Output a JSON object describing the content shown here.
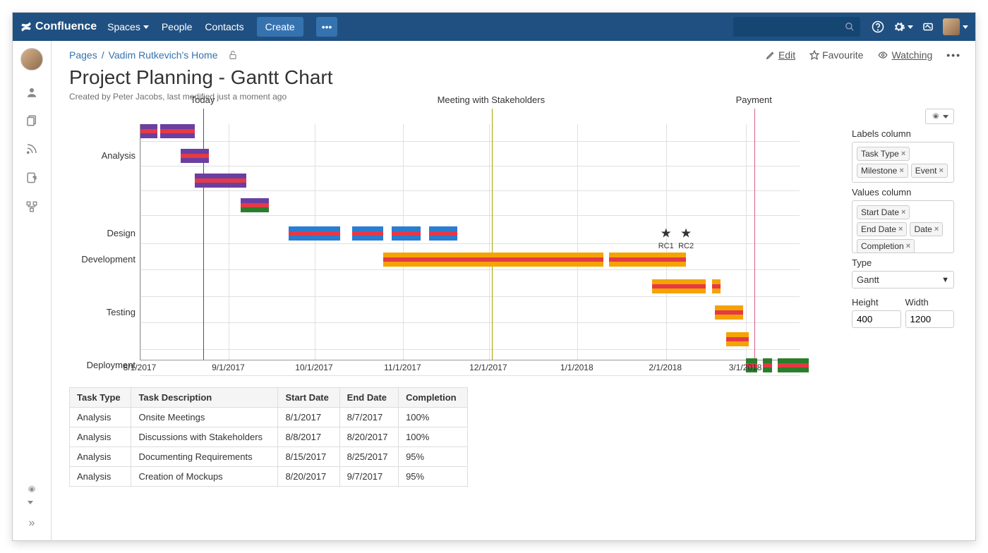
{
  "brand": "Confluence",
  "nav": {
    "spaces": "Spaces",
    "people": "People",
    "contacts": "Contacts",
    "create": "Create",
    "more": "•••"
  },
  "breadcrumb": {
    "root": "Pages",
    "sep": "/",
    "home": "Vadim Rutkevich's Home"
  },
  "actions": {
    "edit": "Edit",
    "favourite": "Favourite",
    "watching": "Watching"
  },
  "page": {
    "title": "Project Planning - Gantt Chart",
    "meta": "Created by Peter Jacobs, last modified just a moment ago"
  },
  "config": {
    "labels_column_label": "Labels column",
    "labels_tags": [
      "Task Type",
      "Milestone",
      "Event"
    ],
    "values_column_label": "Values column",
    "values_tags": [
      "Start Date",
      "End Date",
      "Date",
      "Completion"
    ],
    "type_label": "Type",
    "type_value": "Gantt",
    "height_label": "Height",
    "height_value": "400",
    "width_label": "Width",
    "width_value": "1200"
  },
  "table": {
    "headers": [
      "Task Type",
      "Task Description",
      "Start Date",
      "End Date",
      "Completion"
    ],
    "rows": [
      [
        "Analysis",
        "Onsite Meetings",
        "8/1/2017",
        "8/7/2017",
        "100%"
      ],
      [
        "Analysis",
        "Discussions with Stakeholders",
        "8/8/2017",
        "8/20/2017",
        "100%"
      ],
      [
        "Analysis",
        "Documenting Requirements",
        "8/15/2017",
        "8/25/2017",
        "95%"
      ],
      [
        "Analysis",
        "Creation of Mockups",
        "8/20/2017",
        "9/7/2017",
        "95%"
      ]
    ]
  },
  "chart_data": {
    "type": "gantt",
    "x_axis": [
      "8/1/2017",
      "9/1/2017",
      "10/1/2017",
      "11/1/2017",
      "12/1/2017",
      "1/1/2018",
      "2/1/2018",
      "3/1/2018"
    ],
    "x_start": "8/1/2017",
    "x_end_approx": "3/20/2018",
    "categories": [
      "",
      "Analysis",
      "",
      "Design",
      "Development",
      "",
      "Testing",
      "",
      "Deployment"
    ],
    "events": [
      {
        "label": "Today",
        "date": "8/23/2017",
        "color": "#555"
      },
      {
        "label": "Meeting with Stakeholders",
        "date": "12/2/2017",
        "color": "#a5a500"
      },
      {
        "label": "Payment",
        "date": "3/4/2018",
        "color": "#e05c8a"
      }
    ],
    "milestones": [
      {
        "label": "RC1",
        "date": "2/1/2018",
        "row": 4
      },
      {
        "label": "RC2",
        "date": "2/8/2018",
        "row": 4
      }
    ],
    "bars": [
      {
        "row": 0,
        "start": "8/1/2017",
        "end": "8/7/2017",
        "colors": [
          "#6b3fa0",
          "#e63946",
          "#6b3fa0"
        ]
      },
      {
        "row": 0,
        "start": "8/8/2017",
        "end": "8/20/2017",
        "colors": [
          "#6b3fa0",
          "#e63946",
          "#6b3fa0"
        ]
      },
      {
        "row": 1,
        "start": "8/15/2017",
        "end": "8/25/2017",
        "colors": [
          "#6b3fa0",
          "#e63946",
          "#6b3fa0"
        ],
        "partial": [
          0,
          0.95,
          "#2a7e2a"
        ]
      },
      {
        "row": 2,
        "start": "8/20/2017",
        "end": "9/7/2017",
        "colors": [
          "#6b3fa0",
          "#e63946",
          "#6b3fa0"
        ]
      },
      {
        "row": 3,
        "start": "9/5/2017",
        "end": "9/15/2017",
        "colors": [
          "#6b3fa0",
          "#e63946",
          "#2a7e2a"
        ]
      },
      {
        "row": 4,
        "start": "9/22/2017",
        "end": "10/10/2017",
        "colors": [
          "#2a7dd1",
          "#e63946",
          "#2a7dd1"
        ]
      },
      {
        "row": 4,
        "start": "10/14/2017",
        "end": "10/25/2017",
        "colors": [
          "#2a7dd1",
          "#e63946",
          "#2a7dd1"
        ]
      },
      {
        "row": 4,
        "start": "10/28/2017",
        "end": "11/7/2017",
        "colors": [
          "#2a7dd1",
          "#e63946",
          "#2a7dd1"
        ]
      },
      {
        "row": 4,
        "start": "11/10/2017",
        "end": "11/20/2017",
        "colors": [
          "#2a7dd1",
          "#e63946",
          "#2a7dd1"
        ]
      },
      {
        "row": 5,
        "start": "10/25/2017",
        "end": "1/10/2018",
        "colors": [
          "#f4a300",
          "#e63946",
          "#f4a300"
        ]
      },
      {
        "row": 5,
        "start": "1/12/2018",
        "end": "2/8/2018",
        "colors": [
          "#f4a300",
          "#e63946",
          "#f4a300"
        ]
      },
      {
        "row": 6,
        "start": "1/27/2018",
        "end": "2/15/2018",
        "colors": [
          "#f4a300",
          "#e63946",
          "#f4a300"
        ]
      },
      {
        "row": 6,
        "start": "2/17/2018",
        "end": "2/20/2018",
        "colors": [
          "#f4a300",
          "#e63946",
          "#f4a300"
        ]
      },
      {
        "row": 7,
        "start": "2/18/2018",
        "end": "2/28/2018",
        "colors": [
          "#f4a300",
          "#e63946",
          "#f4a300"
        ]
      },
      {
        "row": 8,
        "start": "2/22/2018",
        "end": "3/2/2018",
        "colors": [
          "#f4a300",
          "#e63946",
          "#f4a300"
        ]
      },
      {
        "row": 9,
        "start": "3/1/2018",
        "end": "3/5/2018",
        "colors": [
          "#2a7e2a",
          "#e63946",
          "#2a7e2a"
        ]
      },
      {
        "row": 9,
        "start": "3/7/2018",
        "end": "3/10/2018",
        "colors": [
          "#2a7e2a",
          "#e63946",
          "#2a7e2a"
        ]
      },
      {
        "row": 9,
        "start": "3/12/2018",
        "end": "3/23/2018",
        "colors": [
          "#2a7e2a",
          "#e63946",
          "#2a7e2a"
        ]
      }
    ],
    "row_y_positions": [
      0,
      35,
      70,
      105,
      145,
      182,
      220,
      257,
      295,
      332
    ],
    "category_rows": {
      "": 0,
      "Analysis": 1,
      "Design": 4,
      "Development": 5,
      "Testing": 7,
      "Deployment": 9
    }
  }
}
